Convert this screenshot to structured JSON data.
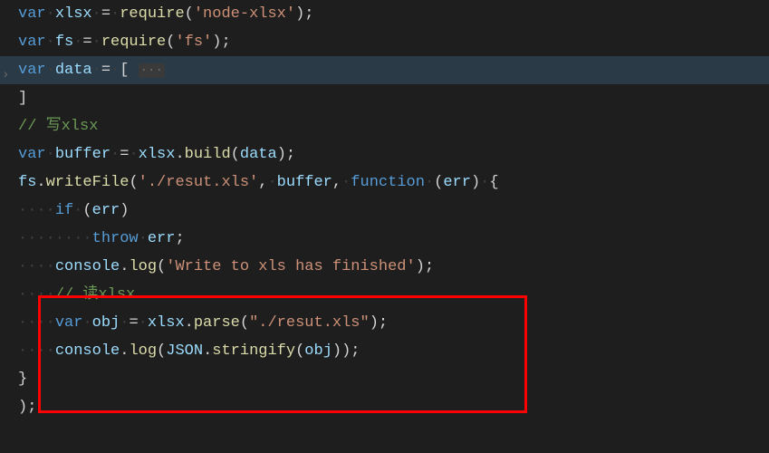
{
  "code": {
    "l1": {
      "kw_var": "var",
      "var_xlsx": "xlsx",
      "fn_require": "require",
      "str_nodexlsx": "'node-xlsx'"
    },
    "l2": {
      "kw_var": "var",
      "var_fs": "fs",
      "fn_require": "require",
      "str_fs": "'fs'"
    },
    "l3": {
      "kw_var": "var",
      "var_data": "data",
      "collapse": "···"
    },
    "l4": {},
    "l5": {
      "comment": "// 写xlsx"
    },
    "l6": {
      "kw_var": "var",
      "var_buffer": "buffer",
      "var_xlsx": "xlsx",
      "fn_build": "build",
      "var_data": "data"
    },
    "l7": {
      "var_fs": "fs",
      "fn_writeFile": "writeFile",
      "str_path": "'./resut.xls'",
      "var_buffer": "buffer",
      "kw_function": "function",
      "var_err": "err"
    },
    "l8": {
      "kw_if": "if",
      "var_err": "err"
    },
    "l9": {
      "kw_throw": "throw",
      "var_err": "err"
    },
    "l10": {
      "var_console": "console",
      "fn_log": "log",
      "str_msg": "'Write to xls has finished'"
    },
    "l11": {
      "comment": "// 读xlsx"
    },
    "l12": {
      "kw_var": "var",
      "var_obj": "obj",
      "var_xlsx": "xlsx",
      "fn_parse": "parse",
      "str_path": "\"./resut.xls\""
    },
    "l13": {
      "var_console": "console",
      "fn_log": "log",
      "var_JSON": "JSON",
      "fn_stringify": "stringify",
      "var_obj": "obj"
    }
  },
  "ws": {
    "dot": "·"
  }
}
